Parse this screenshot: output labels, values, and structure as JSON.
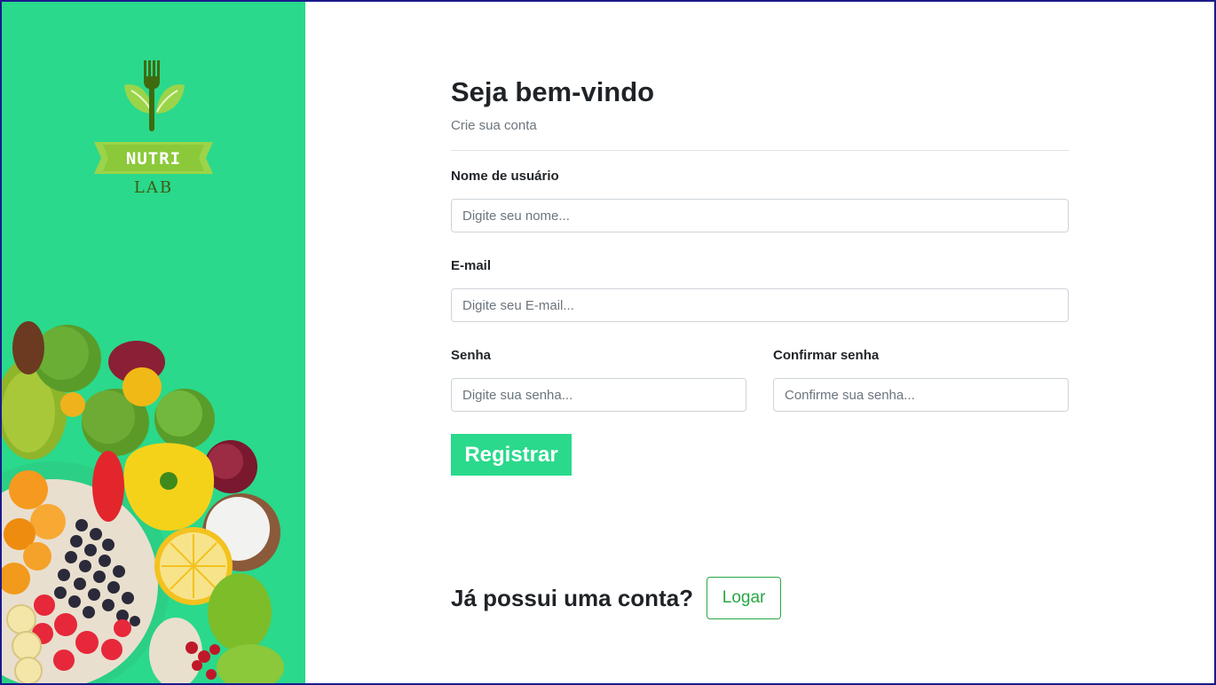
{
  "brand": {
    "name_top": "NUTRI",
    "name_bottom": "LAB",
    "logo_icon": "fork-leaf-icon",
    "accent_color": "#2ad98b",
    "leaf_color": "#9bd44a",
    "fork_color": "#3f6b10"
  },
  "form": {
    "title": "Seja bem-vindo",
    "subtitle": "Crie sua conta",
    "username": {
      "label": "Nome de usuário",
      "placeholder": "Digite seu nome...",
      "value": ""
    },
    "email": {
      "label": "E-mail",
      "placeholder": "Digite seu E-mail...",
      "value": ""
    },
    "password": {
      "label": "Senha",
      "placeholder": "Digite sua senha...",
      "value": ""
    },
    "confirm_password": {
      "label": "Confirmar senha",
      "placeholder": "Confirme sua senha...",
      "value": ""
    },
    "submit_label": "Registrar"
  },
  "login": {
    "question": "Já possui uma conta?",
    "button_label": "Logar",
    "button_color": "#28a745"
  }
}
